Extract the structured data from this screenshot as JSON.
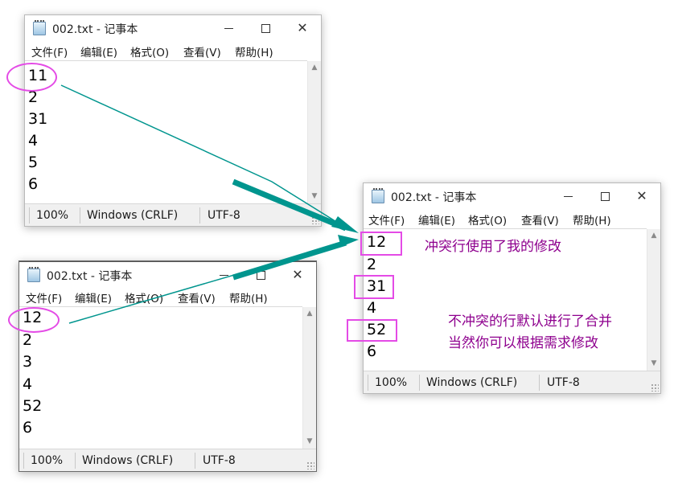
{
  "windows": [
    {
      "title": "002.txt - 记事本",
      "menu": [
        "文件(F)",
        "编辑(E)",
        "格式(O)",
        "查看(V)",
        "帮助(H)"
      ],
      "lines": [
        "11",
        "2",
        "31",
        "4",
        "5",
        "6"
      ],
      "status": {
        "zoom": "100%",
        "line_ending": "Windows (CRLF)",
        "encoding": "UTF-8"
      }
    },
    {
      "title": "002.txt - 记事本",
      "menu": [
        "文件(F)",
        "编辑(E)",
        "格式(O)",
        "查看(V)",
        "帮助(H)"
      ],
      "lines": [
        "12",
        "2",
        "3",
        "4",
        "52",
        "6"
      ],
      "status": {
        "zoom": "100%",
        "line_ending": "Windows (CRLF)",
        "encoding": "UTF-8"
      }
    },
    {
      "title": "002.txt - 记事本",
      "menu": [
        "文件(F)",
        "编辑(E)",
        "格式(O)",
        "查看(V)",
        "帮助(H)"
      ],
      "lines": [
        "12",
        "2",
        "31",
        "4",
        "52",
        "6"
      ],
      "status": {
        "zoom": "100%",
        "line_ending": "Windows (CRLF)",
        "encoding": "UTF-8"
      }
    }
  ],
  "annotations": {
    "conflict_note": "冲突行使用了我的修改",
    "merge_note_line1": "不冲突的行默认进行了合并",
    "merge_note_line2": "当然你可以根据需求修改"
  },
  "colors": {
    "highlight": "#e44be6",
    "note_text": "#8e008e",
    "arrow": "#00958e"
  }
}
